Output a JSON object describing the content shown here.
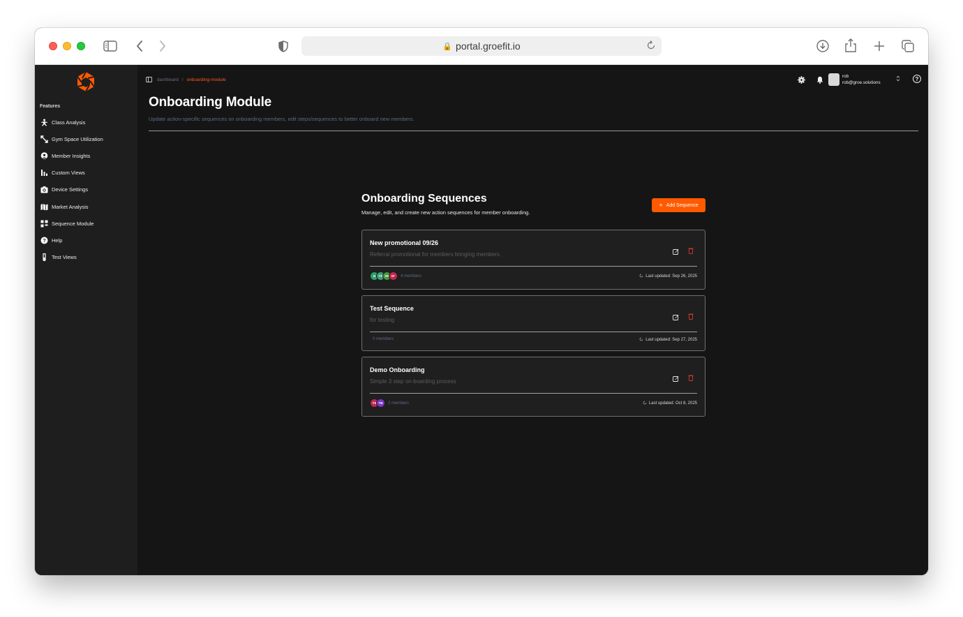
{
  "browser": {
    "url": "portal.groefit.io"
  },
  "sidebar": {
    "section_label": "Features",
    "items": [
      {
        "label": "Class Analysis",
        "icon": "class-analysis-icon"
      },
      {
        "label": "Gym Space Utilization",
        "icon": "resize-arrows-icon"
      },
      {
        "label": "Member Insights",
        "icon": "member-insights-icon"
      },
      {
        "label": "Custom Views",
        "icon": "bar-chart-icon"
      },
      {
        "label": "Device Settings",
        "icon": "camera-icon"
      },
      {
        "label": "Market Analysis",
        "icon": "map-icon"
      },
      {
        "label": "Sequence Module",
        "icon": "grid-icon"
      },
      {
        "label": "Help",
        "icon": "question-circle-icon"
      },
      {
        "label": "Test Views",
        "icon": "test-tube-icon"
      }
    ]
  },
  "breadcrumb": {
    "home": "dashboard",
    "separator": "/",
    "current": "onboarding-module"
  },
  "header": {
    "title": "Onboarding Module",
    "subtitle": "Update action-specific sequences on onboarding members, edit steps/sequences to better onboard new members."
  },
  "user": {
    "name": "rob",
    "email": "rob@groe.solutions"
  },
  "sequences_section": {
    "title": "Onboarding Sequences",
    "subtitle": "Manage, edit, and create new action sequences for member onboarding.",
    "add_button": "Add Sequence"
  },
  "cards": [
    {
      "title": "New promotional 09/26",
      "description": "Referral promotional for members bringing members.",
      "members": "4 members",
      "avatars": [
        {
          "initials": "N",
          "color": "#2e9e6c"
        },
        {
          "initials": "TS",
          "color": "#3a9f7a"
        },
        {
          "initials": "SR",
          "color": "#3f9a3a"
        },
        {
          "initials": "N*",
          "color": "#c2264f"
        }
      ],
      "updated": "Last updated: Sep 26, 2025"
    },
    {
      "title": "Test Sequence",
      "description": "for testing",
      "members": "0 members",
      "avatars": [],
      "updated": "Last updated: Sep 27, 2025"
    },
    {
      "title": "Demo Onboarding",
      "description": "Simple 3 step on-boarding process",
      "members": "2 members",
      "avatars": [
        {
          "initials": "TS",
          "color": "#c2264f"
        },
        {
          "initials": "TB",
          "color": "#7b35c9"
        }
      ],
      "updated": "Last updated: Oct 8, 2025"
    }
  ],
  "colors": {
    "accent": "#ff5a00",
    "background": "#151515",
    "sidebar": "#1e1e1e",
    "delete": "#d53a2b"
  }
}
